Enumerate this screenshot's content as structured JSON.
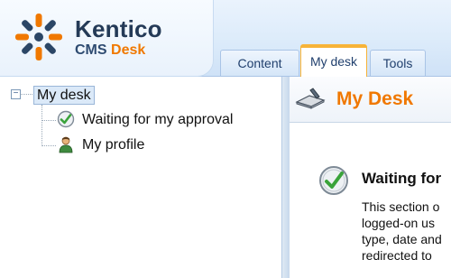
{
  "header": {
    "brand": "Kentico",
    "product_prefix": "CMS",
    "product_suffix": "Desk",
    "tabs": [
      {
        "label": "Content"
      },
      {
        "label": "My desk",
        "active": true
      },
      {
        "label": "Tools"
      }
    ]
  },
  "tree": {
    "expander_symbol": "−",
    "root_label": "My desk",
    "items": [
      {
        "label": "Waiting for my approval",
        "icon": "approval-check-icon"
      },
      {
        "label": "My profile",
        "icon": "user-profile-icon"
      }
    ]
  },
  "content": {
    "page_title": "My Desk",
    "page_icon": "desk-pen-icon",
    "section_title": "Waiting for",
    "section_icon": "approval-check-icon",
    "description_lines": [
      "This section o",
      "logged-on us",
      "type, date and",
      "redirected to"
    ]
  },
  "colors": {
    "accent_orange": "#f07800",
    "header_blue": "#dcebfa",
    "tab_highlight": "#f7b338"
  }
}
